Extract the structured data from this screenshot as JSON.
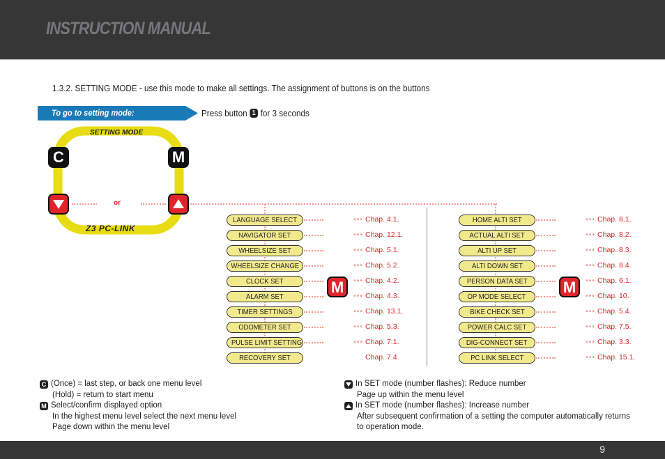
{
  "header": {
    "title": "INSTRUCTION MANUAL"
  },
  "intro": "1.3.2. SETTING MODE - use this mode to make all settings. The assignment of buttons is on the buttons",
  "banner": {
    "label": "To go to setting mode:",
    "instruction_prefix": "Press button",
    "button_glyph": "1",
    "instruction_suffix": "for 3 seconds"
  },
  "device": {
    "top_label": "SETTING MODE",
    "bottom_label": "Z3 PC-LINK",
    "button_c": "C",
    "button_m": "M",
    "or_label": "or"
  },
  "menu_left": {
    "m_button": "M",
    "items": [
      {
        "label": "LANGUAGE SELECT",
        "chap": "Chap. 4.1.",
        "dots": true
      },
      {
        "label": "NAVIGATOR SET",
        "chap": "Chap. 12.1.",
        "dots": true
      },
      {
        "label": "WHEELSIZE SET",
        "chap": "Chap. 5.1.",
        "dots": true
      },
      {
        "label": "WHEELSIZE CHANGE",
        "chap": "Chap. 5.2.",
        "dots": true
      },
      {
        "label": "CLOCK SET",
        "chap": "Chap. 4.2.",
        "dots": true
      },
      {
        "label": "ALARM SET",
        "chap": "Chap. 4.3.",
        "dots": true
      },
      {
        "label": "TIMER SETTINGS",
        "chap": "Chap. 13.1.",
        "dots": true
      },
      {
        "label": "ODOMETER SET",
        "chap": "Chap. 5.3.",
        "dots": true
      },
      {
        "label": "PULSE LIMIT SETTINGS",
        "chap": "Chap. 7.1.",
        "dots": true
      },
      {
        "label": "RECOVERY SET",
        "chap": "Chap. 7.4.",
        "dots": false
      }
    ]
  },
  "menu_right": {
    "m_button": "M",
    "items": [
      {
        "label": "HOME ALTI SET",
        "chap": "Chap. 8.1.",
        "dots": true
      },
      {
        "label": "ACTUAL ALTI SET",
        "chap": "Chap. 8.2.",
        "dots": true
      },
      {
        "label": "ALTI UP SET",
        "chap": "Chap. 8.3.",
        "dots": true
      },
      {
        "label": "ALTI DOWN SET",
        "chap": "Chap. 8.4.",
        "dots": true
      },
      {
        "label": "PERSON DATA SET",
        "chap": "Chap. 6.1.",
        "dots": true
      },
      {
        "label": "OP MODE SELECT",
        "chap": "Chap. 10.",
        "dots": true
      },
      {
        "label": "BIKE CHECK SET",
        "chap": "Chap. 5.4.",
        "dots": true
      },
      {
        "label": "POWER CALC SET",
        "chap": "Chap. 7.5.",
        "dots": true
      },
      {
        "label": "DIG-CONNECT SET",
        "chap": "Chap. 3.3.",
        "dots": true
      },
      {
        "label": "PC LINK SELECT",
        "chap": "Chap. 15.1.",
        "dots": true
      }
    ]
  },
  "legend_left": {
    "c_glyph": "C",
    "c_line1": "(Once) = last step, or back one menu level",
    "c_line2": "(Hold) = return to start menu",
    "m_glyph": "M",
    "m_line1": "Select/confirm displayed option",
    "m_line2": "In the highest menu level select the next menu level",
    "m_line3": "Page down within the menu level"
  },
  "legend_right": {
    "down_line1": "In SET mode (number flashes): Reduce number",
    "down_line2": "Page up within the menu level",
    "up_line1": "In SET mode (number flashes): Increase number",
    "up_line2": "After subsequent confirmation of a setting the computer automatically returns",
    "up_line3": "to operation mode."
  },
  "footer": {
    "page_number": "9"
  },
  "colors": {
    "accent_blue": "#1a7ab8",
    "red": "#e0242b",
    "yellow": "#e8dc14",
    "menu_fill": "#f2e98d",
    "header_bg": "#363636"
  }
}
